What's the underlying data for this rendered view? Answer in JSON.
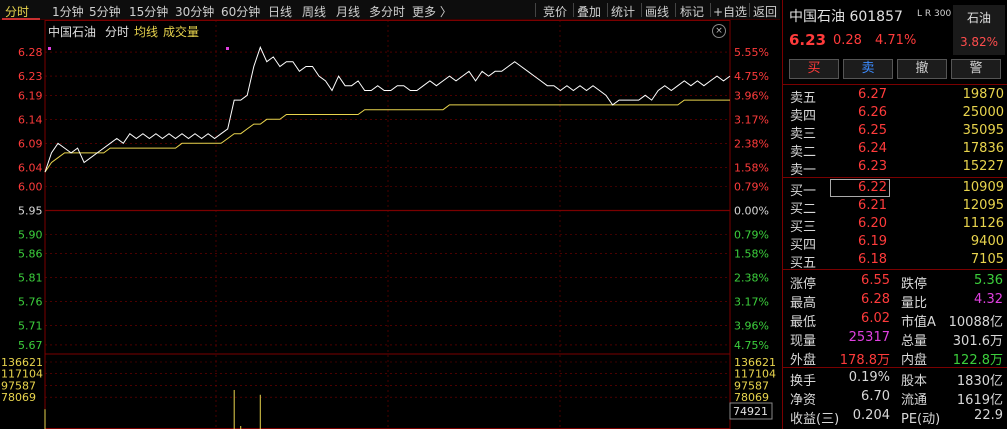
{
  "toolbar": {
    "tabs": [
      "分时",
      "1分钟",
      "5分钟",
      "15分钟",
      "30分钟",
      "60分钟",
      "日线",
      "周线",
      "月线",
      "多分时",
      "更多 〉"
    ],
    "active_tab": "分时",
    "actions": [
      "竞价",
      "叠加",
      "统计",
      "画线",
      "标记",
      "+自选",
      "返回"
    ]
  },
  "chart": {
    "legend_name": "中国石油",
    "legend_mode": "分时",
    "legend_avg": "均线",
    "legend_volume": "成交量",
    "close_glyph": "×",
    "volume_marker": "74921",
    "colors": {
      "price": "#ffffff",
      "avg": "#e8d44d",
      "up": "#ff3b3b",
      "down": "#3ccf3c",
      "grid": "#7a0000",
      "volume": "#e8d44d"
    }
  },
  "chart_data": {
    "type": "line",
    "price_ticks": [
      "6.28",
      "6.23",
      "6.19",
      "6.14",
      "6.09",
      "6.04",
      "6.00",
      "5.95",
      "5.90",
      "5.86",
      "5.81",
      "5.76",
      "5.71",
      "5.67"
    ],
    "pct_ticks": [
      "5.55%",
      "4.75%",
      "3.96%",
      "3.17%",
      "2.38%",
      "1.58%",
      "0.79%",
      "0.00%",
      "0.79%",
      "1.58%",
      "2.38%",
      "3.17%",
      "3.96%",
      "4.75%"
    ],
    "volume_ticks": [
      "136621",
      "117104",
      "97587",
      "78069"
    ],
    "ylim": [
      5.649,
      6.301
    ],
    "prev_close": 5.95,
    "series": [
      {
        "values": [
          6.03,
          6.07,
          6.09,
          6.08,
          6.07,
          6.08,
          6.05,
          6.06,
          6.07,
          6.08,
          6.09,
          6.1,
          6.09,
          6.11,
          6.1,
          6.11,
          6.1,
          6.11,
          6.1,
          6.11,
          6.1,
          6.11,
          6.1,
          6.11,
          6.1,
          6.11,
          6.1,
          6.11,
          6.12,
          6.18,
          6.18,
          6.19,
          6.25,
          6.29,
          6.26,
          6.27,
          6.25,
          6.26,
          6.26,
          6.24,
          6.25,
          6.25,
          6.23,
          6.22,
          6.2,
          6.23,
          6.21,
          6.21,
          6.22,
          6.2,
          6.2,
          6.21,
          6.2,
          6.2,
          6.21,
          6.21,
          6.2,
          6.2,
          6.21,
          6.22,
          6.21,
          6.22,
          6.23,
          6.22,
          6.23,
          6.24,
          6.22,
          6.24,
          6.23,
          6.24,
          6.24,
          6.25,
          6.26,
          6.25,
          6.24,
          6.23,
          6.22,
          6.21,
          6.21,
          6.2,
          6.21,
          6.2,
          6.21,
          6.2,
          6.21,
          6.2,
          6.19,
          6.17,
          6.18,
          6.18,
          6.18,
          6.18,
          6.19,
          6.18,
          6.2,
          6.21,
          6.2,
          6.21,
          6.22,
          6.21,
          6.22,
          6.21,
          6.22,
          6.23,
          6.22,
          6.23
        ]
      },
      {
        "values": [
          6.03,
          6.05,
          6.06,
          6.07,
          6.07,
          6.07,
          6.07,
          6.07,
          6.07,
          6.07,
          6.08,
          6.08,
          6.08,
          6.08,
          6.08,
          6.08,
          6.08,
          6.08,
          6.08,
          6.08,
          6.08,
          6.09,
          6.09,
          6.09,
          6.09,
          6.09,
          6.09,
          6.09,
          6.1,
          6.11,
          6.11,
          6.12,
          6.13,
          6.13,
          6.14,
          6.14,
          6.14,
          6.15,
          6.15,
          6.15,
          6.15,
          6.15,
          6.15,
          6.15,
          6.15,
          6.15,
          6.15,
          6.15,
          6.15,
          6.16,
          6.16,
          6.16,
          6.16,
          6.16,
          6.16,
          6.16,
          6.16,
          6.16,
          6.16,
          6.16,
          6.16,
          6.16,
          6.17,
          6.17,
          6.17,
          6.17,
          6.17,
          6.17,
          6.17,
          6.17,
          6.17,
          6.17,
          6.17,
          6.17,
          6.17,
          6.17,
          6.17,
          6.17,
          6.17,
          6.17,
          6.17,
          6.17,
          6.17,
          6.17,
          6.17,
          6.17,
          6.17,
          6.17,
          6.17,
          6.17,
          6.17,
          6.17,
          6.17,
          6.17,
          6.17,
          6.17,
          6.17,
          6.17,
          6.18,
          6.18,
          6.18,
          6.18,
          6.18,
          6.18,
          6.18,
          6.18
        ]
      }
    ],
    "volume_ylim": [
      0,
      136621
    ],
    "volume_bars": [
      58000,
      8000,
      6000,
      5000,
      5000,
      4000,
      5000,
      5000,
      4000,
      4000,
      4000,
      4000,
      4000,
      4000,
      4000,
      3000,
      3000,
      3000,
      3000,
      3000,
      3000,
      3000,
      3000,
      3000,
      3000,
      3000,
      3000,
      3000,
      3000,
      90000,
      30000,
      12000,
      10000,
      82000,
      15000,
      10000,
      8000,
      8000,
      6000,
      6000,
      5000,
      5000,
      5000,
      5000,
      5000,
      4000,
      4000,
      4000,
      4000,
      4000,
      4000,
      4000,
      4000,
      4000,
      4000,
      4000,
      4000,
      4000,
      4000,
      4000,
      4000,
      4000,
      4000,
      4000,
      4000,
      4000,
      4000,
      4000,
      4000,
      4000,
      4000,
      4000,
      4000,
      4000,
      4000,
      4000,
      4000,
      4000,
      4000,
      4000,
      4000,
      4000,
      4000,
      4000,
      4000,
      4000,
      4000,
      4000,
      4000,
      4000,
      4000,
      4000,
      4000,
      4000,
      4000,
      4000,
      4000,
      4000,
      4000,
      4000,
      4000,
      4000,
      4000,
      4000,
      4000,
      4000
    ]
  },
  "quote": {
    "name": "中国石油",
    "code": "601857",
    "tag": "L R 300",
    "sector": "石油",
    "sector_pct": "3.82%",
    "price": "6.23",
    "change": "0.28",
    "pct": "4.71%"
  },
  "trade_buttons": [
    {
      "label": "买",
      "color": "#ff3b3b"
    },
    {
      "label": "卖",
      "color": "#3c8cff"
    },
    {
      "label": "撤",
      "color": "#d0d0d0"
    },
    {
      "label": "警",
      "color": "#d0d0d0"
    }
  ],
  "orderbook": {
    "asks": [
      {
        "label": "卖五",
        "price": "6.27",
        "vol": "19870"
      },
      {
        "label": "卖四",
        "price": "6.26",
        "vol": "25000"
      },
      {
        "label": "卖三",
        "price": "6.25",
        "vol": "35095"
      },
      {
        "label": "卖二",
        "price": "6.24",
        "vol": "17836"
      },
      {
        "label": "卖一",
        "price": "6.23",
        "vol": "15227"
      }
    ],
    "bids": [
      {
        "label": "买一",
        "price": "6.22",
        "vol": "10909"
      },
      {
        "label": "买二",
        "price": "6.21",
        "vol": "12095"
      },
      {
        "label": "买三",
        "price": "6.20",
        "vol": "11126"
      },
      {
        "label": "买四",
        "price": "6.19",
        "vol": "9400"
      },
      {
        "label": "买五",
        "price": "6.18",
        "vol": "7105"
      }
    ]
  },
  "stats": {
    "limit_up_label": "涨停",
    "limit_up": "6.55",
    "limit_down_label": "跌停",
    "limit_down": "5.36",
    "high_label": "最高",
    "high": "6.28",
    "vol_ratio_label": "量比",
    "vol_ratio": "4.32",
    "low_label": "最低",
    "low": "6.02",
    "mcap_label": "市值A",
    "mcap": "10088亿",
    "cur_vol_label": "现量",
    "cur_vol": "25317",
    "total_vol_label": "总量",
    "total_vol": "301.6万",
    "outer_label": "外盘",
    "outer": "178.8万",
    "inner_label": "内盘",
    "inner": "122.8万",
    "turnover_label": "换手",
    "turnover": "0.19%",
    "equity_label": "股本",
    "equity": "1830亿",
    "nav_label": "净资",
    "nav": "6.70",
    "float_label": "流通",
    "float": "1619亿",
    "eps_label": "收益(三)",
    "eps": "0.204",
    "pe_label": "PE(动)",
    "pe": "22.9"
  }
}
